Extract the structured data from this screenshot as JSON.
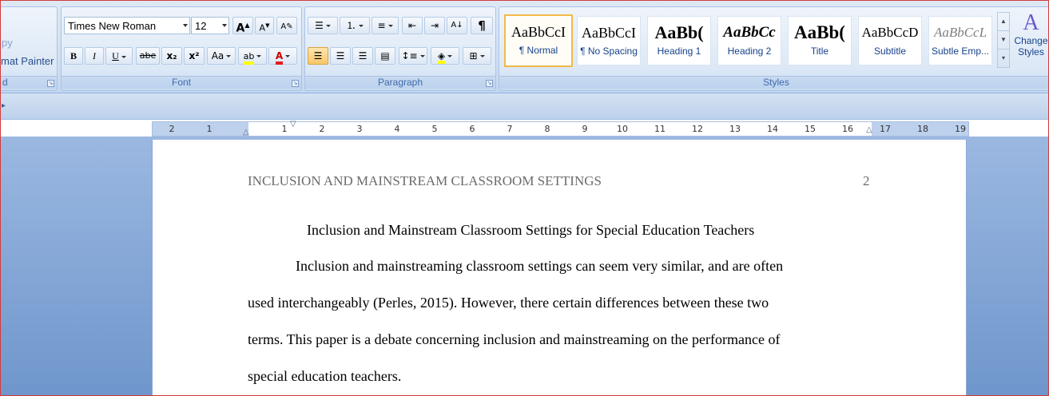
{
  "clipboard": {
    "copy_label": "py",
    "format_painter_label": "mat Painter",
    "group_label": "d"
  },
  "font": {
    "font_name": "Times New Roman",
    "font_size": "12",
    "grow_label": "A",
    "shrink_label": "A",
    "bold": "B",
    "italic": "I",
    "underline": "U",
    "strike": "abe",
    "subscript": "x₂",
    "superscript": "x²",
    "change_case": "Aa",
    "highlight": "ab",
    "font_color": "A",
    "group_label": "Font",
    "highlight_color": "#ffff00",
    "font_color_value": "#e01f1f"
  },
  "paragraph": {
    "group_label": "Paragraph",
    "show_marks": "¶",
    "sort_label": "A↓",
    "active_align": "align-left"
  },
  "styles": {
    "group_label": "Styles",
    "items": [
      {
        "sample": "AaBbCcI",
        "name": "¶ Normal",
        "selected": true
      },
      {
        "sample": "AaBbCcI",
        "name": "¶ No Spacing"
      },
      {
        "sample": "AaBb(",
        "name": "Heading 1"
      },
      {
        "sample": "AaBbCc",
        "name": "Heading 2"
      },
      {
        "sample": "AaBb(",
        "name": "Title"
      },
      {
        "sample": "AaBbCcD",
        "name": "Subtitle"
      },
      {
        "sample": "AaBbCcL",
        "name": "Subtle Emp..."
      }
    ],
    "change_styles_line1": "Change",
    "change_styles_line2": "Styles",
    "change_styles_icon": "A"
  },
  "ruler": {
    "labels": [
      "2",
      "1",
      "1",
      "2",
      "3",
      "4",
      "5",
      "6",
      "7",
      "8",
      "9",
      "10",
      "11",
      "12",
      "13",
      "14",
      "15",
      "16",
      "17",
      "18",
      "19"
    ]
  },
  "document": {
    "header": "INCLUSION AND MAINSTREAM CLASSROOM SETTINGS",
    "page_number": "2",
    "title": "Inclusion and Mainstream Classroom Settings for Special Education Teachers",
    "lines": [
      "Inclusion and mainstreaming classroom settings can seem very similar, and are often",
      "used interchangeably (Perles, 2015). However, there certain differences between these two",
      "terms. This paper is a debate concerning inclusion and mainstreaming on the performance of",
      "special education teachers."
    ]
  }
}
